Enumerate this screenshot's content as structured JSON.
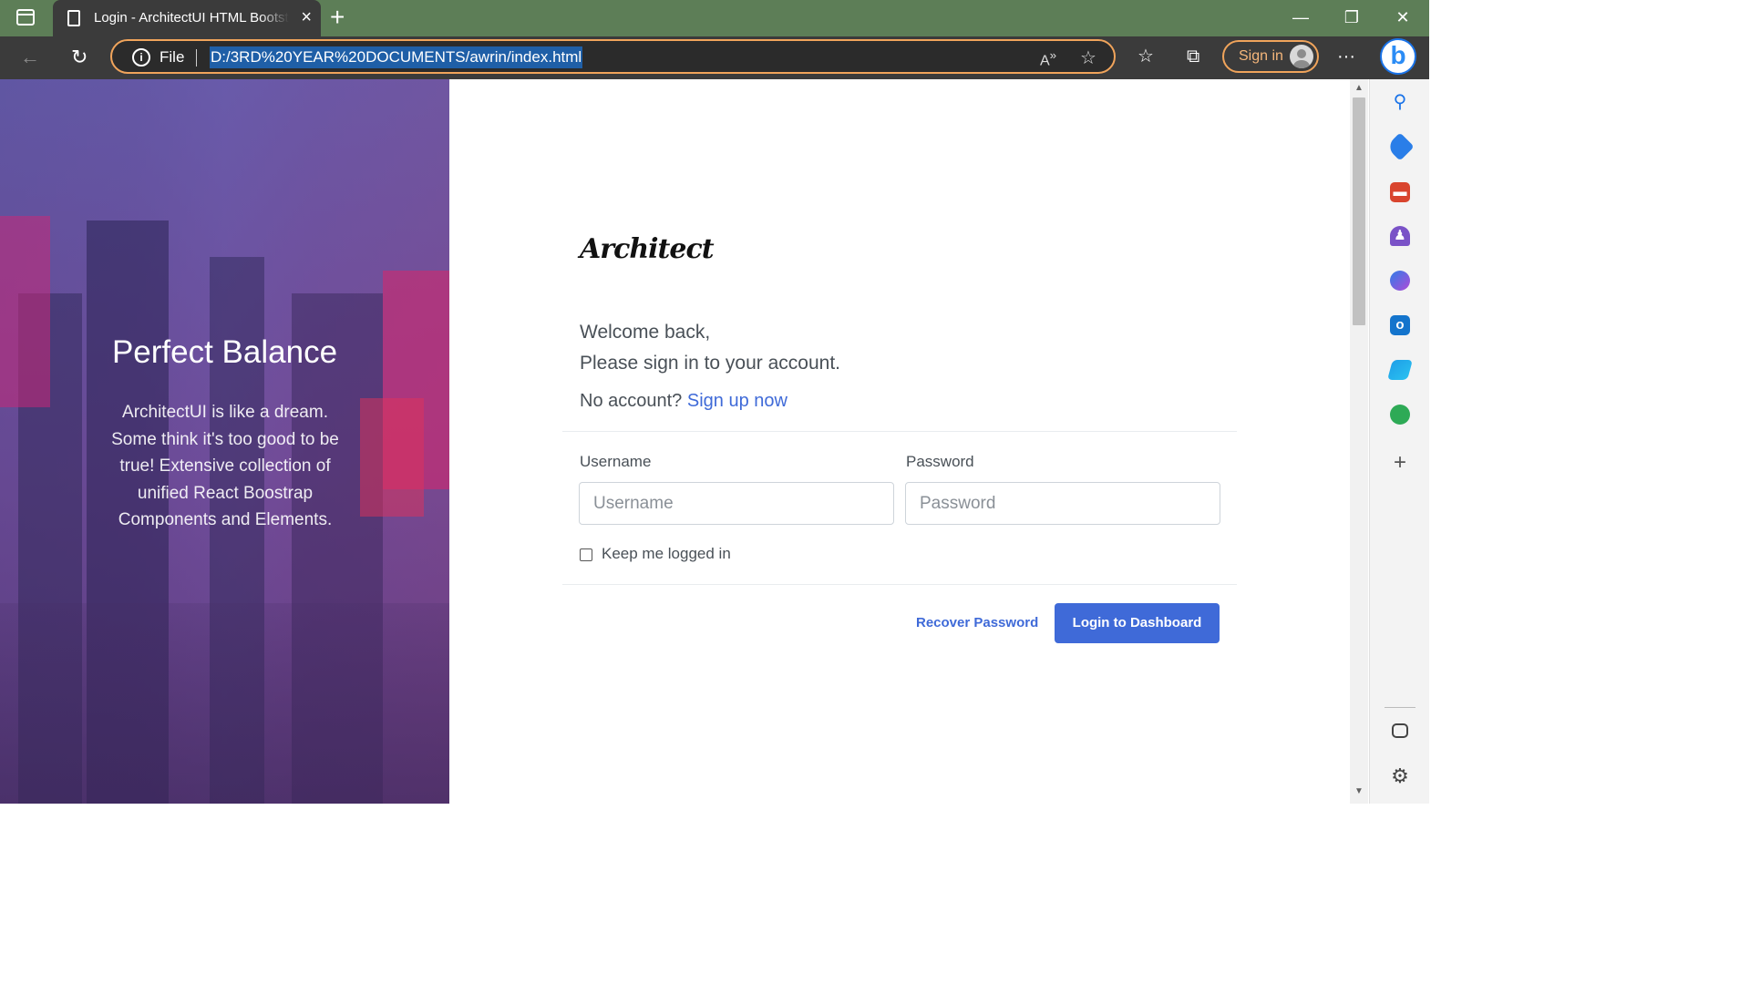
{
  "browser": {
    "tab_title": "Login - ArchitectUI HTML Bootstrap",
    "tab_close": "×",
    "new_tab": "+",
    "window_buttons": {
      "minimize": "—",
      "restore": "❐",
      "close": "✕"
    },
    "url_scheme_label": "File",
    "url": "D:/3RD%20YEAR%20DOCUMENTS/awrin/index.html",
    "sign_in_label": "Sign in",
    "more": "···"
  },
  "hero": {
    "title": "Perfect Balance",
    "text": "ArchitectUI is like a dream. Some think it's too good to be true! Extensive collection of unified React Boostrap Components and Elements."
  },
  "login": {
    "logo": "Architect",
    "welcome_line1": "Welcome back,",
    "welcome_line2": "Please sign in to your account.",
    "no_account": "No account?",
    "signup_link": "Sign up now",
    "username_label": "Username",
    "username_placeholder": "Username",
    "username_value": "",
    "password_label": "Password",
    "password_placeholder": "Password",
    "password_value": "",
    "keep_logged_in": "Keep me logged in",
    "keep_logged_in_checked": false,
    "recover_link": "Recover Password",
    "login_button": "Login to Dashboard"
  },
  "colors": {
    "accent": "#3f6ad8",
    "chrome_dark": "#3b3b3b",
    "titlebar": "#5d7e57",
    "url_outline": "#f0a45b"
  },
  "sidebar_icons": [
    "search-icon",
    "tag-icon",
    "toolbox-icon",
    "chess-icon",
    "copilot-icon",
    "outlook-icon",
    "send-icon",
    "tree-icon",
    "add-icon",
    "split-screen-icon",
    "settings-icon"
  ]
}
